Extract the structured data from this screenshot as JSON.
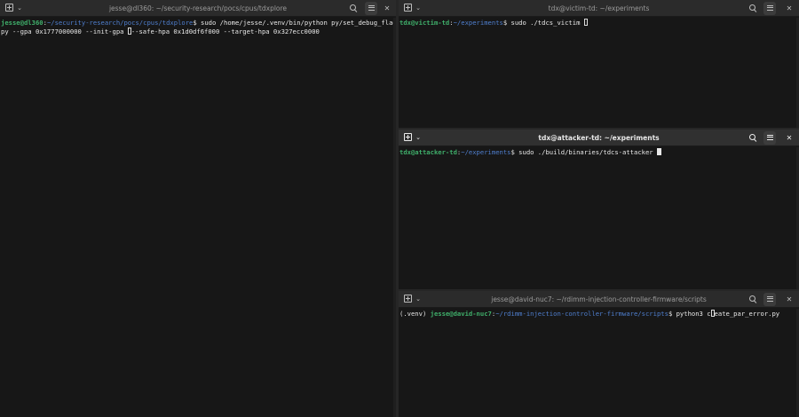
{
  "panes": {
    "left": {
      "title": "jesse@dl360: ~/security-research/pocs/cpus/tdxplore",
      "user": "jesse@dl360",
      "sep": ":",
      "path": "~/security-research/pocs/cpus/tdxplore",
      "prompt_char": "$ ",
      "command_line1": "sudo /home/jesse/.venv/bin/python py/set_debug_flag.",
      "command_line2_a": "py --gpa 0x1777000000 --init-gpa ",
      "command_line2_b": "--safe-hpa 0x1d0df6f000 --target-hpa 0x327ecc0000"
    },
    "victim": {
      "title": "tdx@victim-td: ~/experiments",
      "user": "tdx@victim-td",
      "sep": ":",
      "path": "~/experiments",
      "prompt_char": "$ ",
      "command": "sudo ./tdcs_victim"
    },
    "attacker": {
      "title": "tdx@attacker-td: ~/experiments",
      "user": "tdx@attacker-td",
      "sep": ":",
      "path": "~/experiments",
      "prompt_char": "$ ",
      "command": "sudo ./build/binaries/tdcs-attacker "
    },
    "nuc": {
      "title": "jesse@david-nuc7: ~/rdimm-injection-controller-firmware/scripts",
      "venv": "(.venv) ",
      "user": "jesse@david-nuc7",
      "sep": ":",
      "path": "~/rdimm-injection-controller-firmware/scripts",
      "prompt_char": "$ ",
      "command_a": "python3 c",
      "command_b": "eate_par_error.py"
    }
  },
  "buttons": {
    "new_tab": "new-tab",
    "chevron": "⌄",
    "close": "✕"
  },
  "colors": {
    "background": "#171717",
    "titlebar": "#2b2b2b",
    "user_green": "#3fae6a",
    "path_blue": "#4f7fcf",
    "text": "#e4e4e4"
  }
}
